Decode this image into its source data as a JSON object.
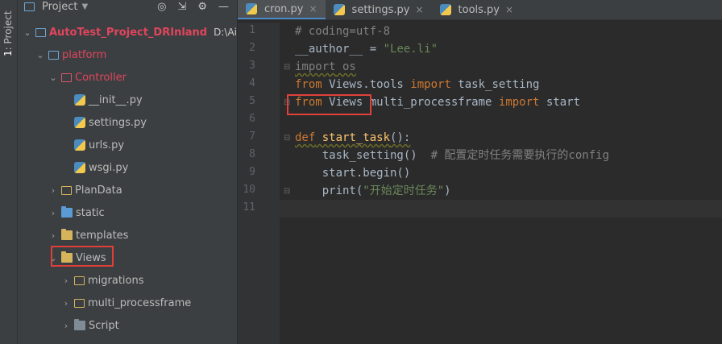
{
  "left_strip": {
    "number": "1",
    "label": ": Project"
  },
  "sidebar": {
    "title": "Project",
    "tree": [
      {
        "label": "AutoTest_Project_DRInland",
        "path": "D:\\AirtestID"
      },
      {
        "label": "platform"
      },
      {
        "label": "Controller"
      },
      {
        "label": "__init__.py"
      },
      {
        "label": "settings.py"
      },
      {
        "label": "urls.py"
      },
      {
        "label": "wsgi.py"
      },
      {
        "label": "PlanData"
      },
      {
        "label": "static"
      },
      {
        "label": "templates"
      },
      {
        "label": "Views"
      },
      {
        "label": "migrations"
      },
      {
        "label": "multi_processframe"
      },
      {
        "label": "Script"
      }
    ]
  },
  "tabs": [
    {
      "label": "cron.py",
      "active": true
    },
    {
      "label": "settings.py",
      "active": false
    },
    {
      "label": "tools.py",
      "active": false
    }
  ],
  "code": {
    "line_numbers": [
      "1",
      "2",
      "3",
      "4",
      "5",
      "6",
      "7",
      "8",
      "9",
      "10",
      "11"
    ],
    "l1": "# coding=utf-8",
    "l2_name": "__author__",
    "l2_eq": " = ",
    "l2_str": "\"Lee.li\"",
    "l3_kw": "import",
    "l3_mod": " os",
    "l4_kw1": "from",
    "l4_mod": " Views.tools ",
    "l4_kw2": "import",
    "l4_name": " task_setting",
    "l5_kw1": "from",
    "l5_mod": " Views ",
    "l5_rest": "multi_processframe ",
    "l5_kw2": "import",
    "l5_name": " start",
    "l7_kw": "def",
    "l7_fn": " start_task",
    "l7_rest": "():",
    "l8_code": "    task_setting()  ",
    "l8_cm": "# 配置定时任务需要执行的config",
    "l9_code": "    start.begin()",
    "l10_pre": "    print(",
    "l10_str": "\"开始定时任务\"",
    "l10_post": ")"
  },
  "colors": {
    "keyword": "#cc7832",
    "string": "#6a8759",
    "comment": "#808080",
    "function": "#ffc66d",
    "highlight": "#e0403a"
  }
}
